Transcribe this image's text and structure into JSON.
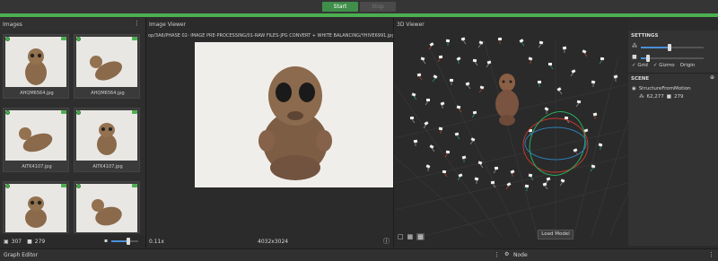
{
  "toolbar": {
    "start_label": "Start",
    "stop_label": "Stop"
  },
  "images_panel": {
    "title": "Images",
    "menu_icon": "more-vertical-icon",
    "thumbnails": [
      {
        "label": "AHQM6564.jpg"
      },
      {
        "label": "AHQM6564.jpg"
      },
      {
        "label": "AITK4107.jpg"
      },
      {
        "label": "AITK4107.jpg"
      },
      {
        "label": ""
      },
      {
        "label": ""
      }
    ],
    "footer": {
      "image_count": "307",
      "camera_count": "279"
    }
  },
  "image_viewer": {
    "title": "Image Viewer",
    "path": "op/3A6/PHASE 02- IMAGE PRE-PROCESSING/01-RAW FILES-JPG CONVERT + WHITE BALANCING/YHIVE6991.jpg",
    "zoom": "0.11x",
    "resolution": "4032x3024"
  },
  "viewer_3d": {
    "title": "3D Viewer",
    "load_model_label": "Load Model"
  },
  "settings": {
    "title": "SETTINGS",
    "grid_label": "Grid",
    "gizmo_label": "Gizmo",
    "origin_label": "Origin",
    "slider1": 0.45,
    "slider2": 0.1
  },
  "scene": {
    "title": "SCENE",
    "node_name": "StructureFromMotion",
    "points": "62,277",
    "cameras": "279"
  },
  "bottom": {
    "graph_editor_label": "Graph Editor",
    "node_label": "Node"
  },
  "colors": {
    "accent_green": "#4caf50",
    "slider_blue": "#4a90d9",
    "ellipse_red": "#c0392b",
    "ellipse_green": "#27ae60",
    "ellipse_blue": "#2c7fb8"
  }
}
